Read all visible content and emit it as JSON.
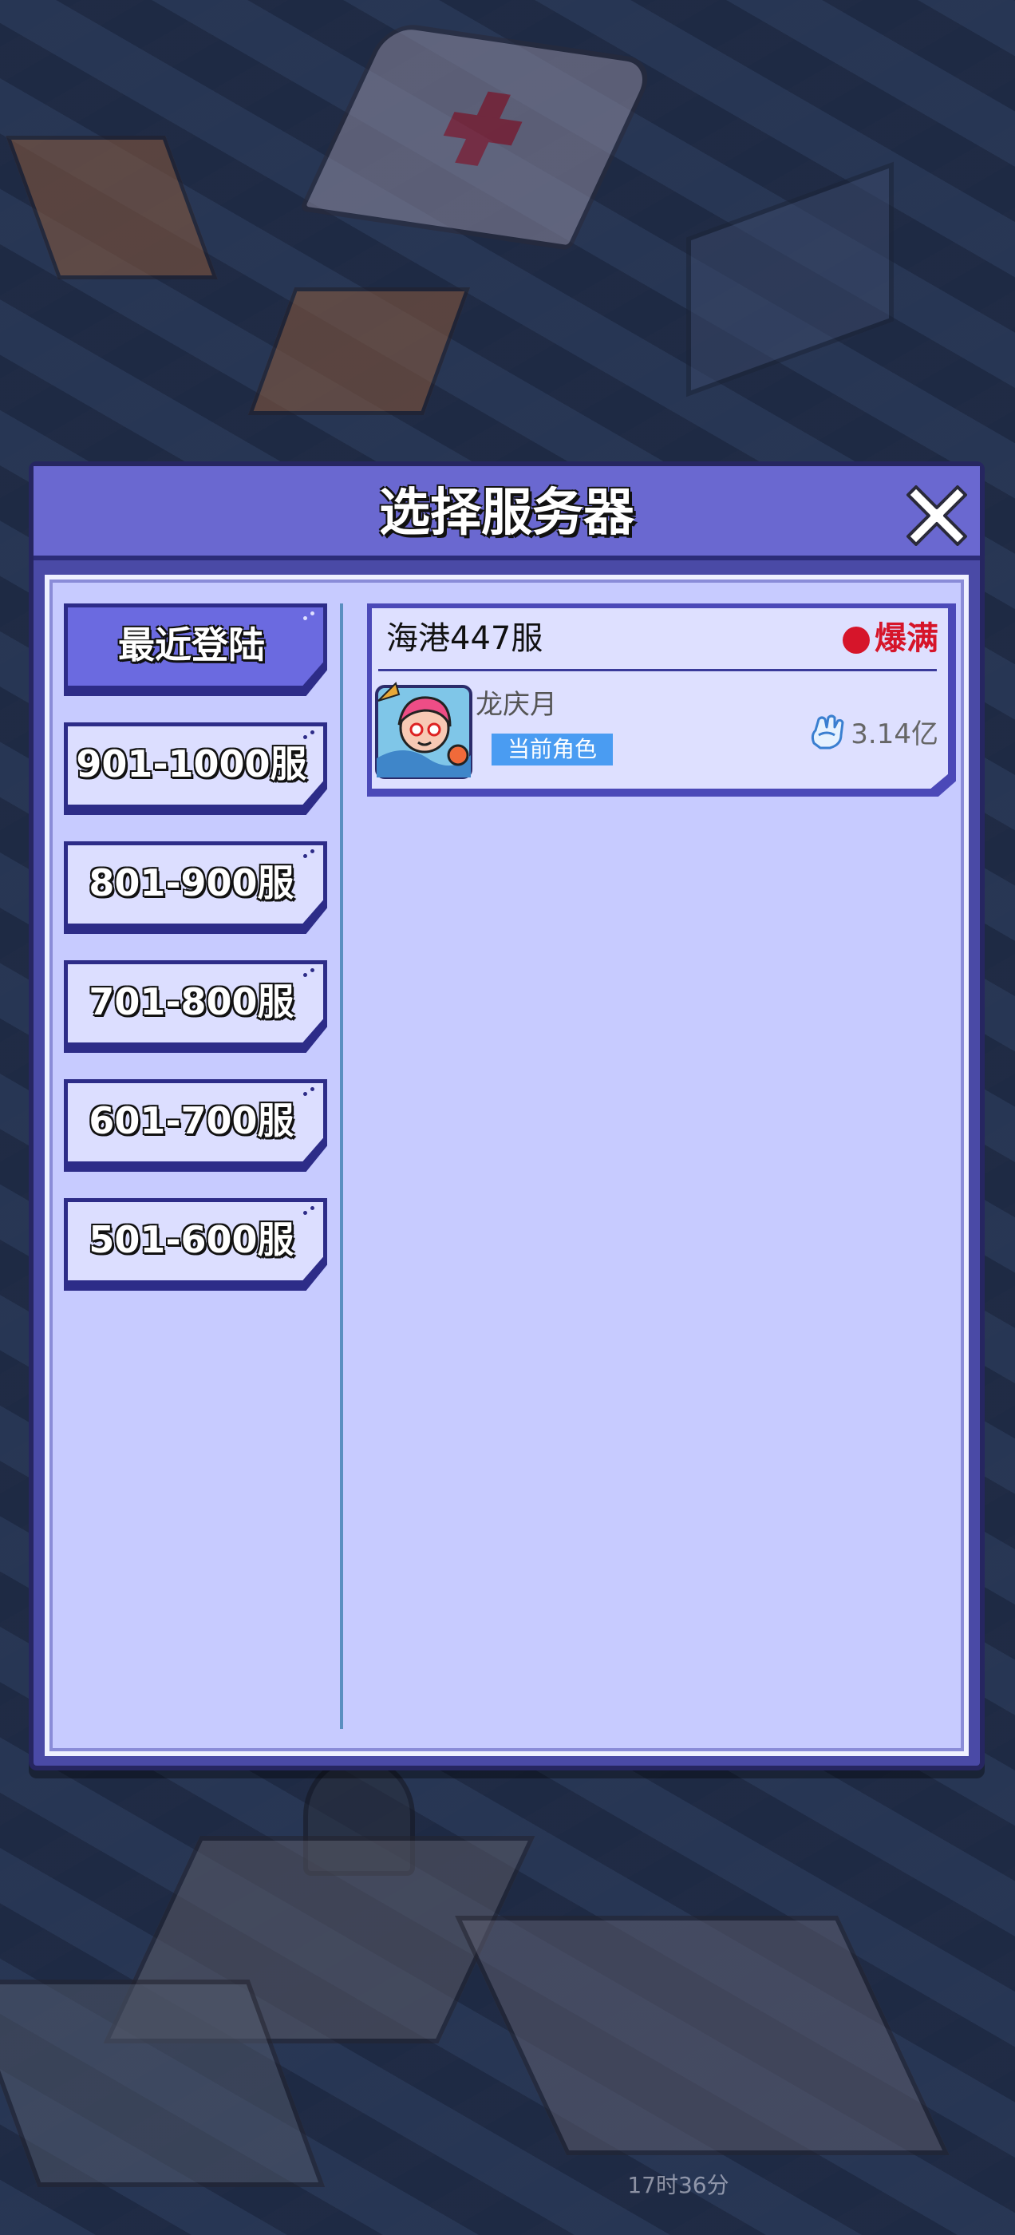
{
  "modal": {
    "title": "选择服务器",
    "close_icon": "close-x-icon"
  },
  "server_groups": [
    {
      "label": "最近登陆",
      "active": true
    },
    {
      "label": "901-1000服",
      "active": false
    },
    {
      "label": "801-900服",
      "active": false
    },
    {
      "label": "701-800服",
      "active": false
    },
    {
      "label": "601-700服",
      "active": false
    },
    {
      "label": "501-600服",
      "active": false
    }
  ],
  "servers": [
    {
      "name": "海港447服",
      "status": "爆满",
      "status_color": "#d6152a",
      "character": {
        "name": "龙庆月",
        "badge": "当前角色",
        "avatar_icon": "character-avatar",
        "power_icon": "fist-icon",
        "power": "3.14亿"
      }
    }
  ],
  "background": {
    "timer": "17时36分"
  },
  "colors": {
    "header": "#6a68d0",
    "panel": "#c7cbff",
    "active_tab": "#6b6ae0",
    "tab": "#dcdeff",
    "badge": "#4a9cf2"
  }
}
